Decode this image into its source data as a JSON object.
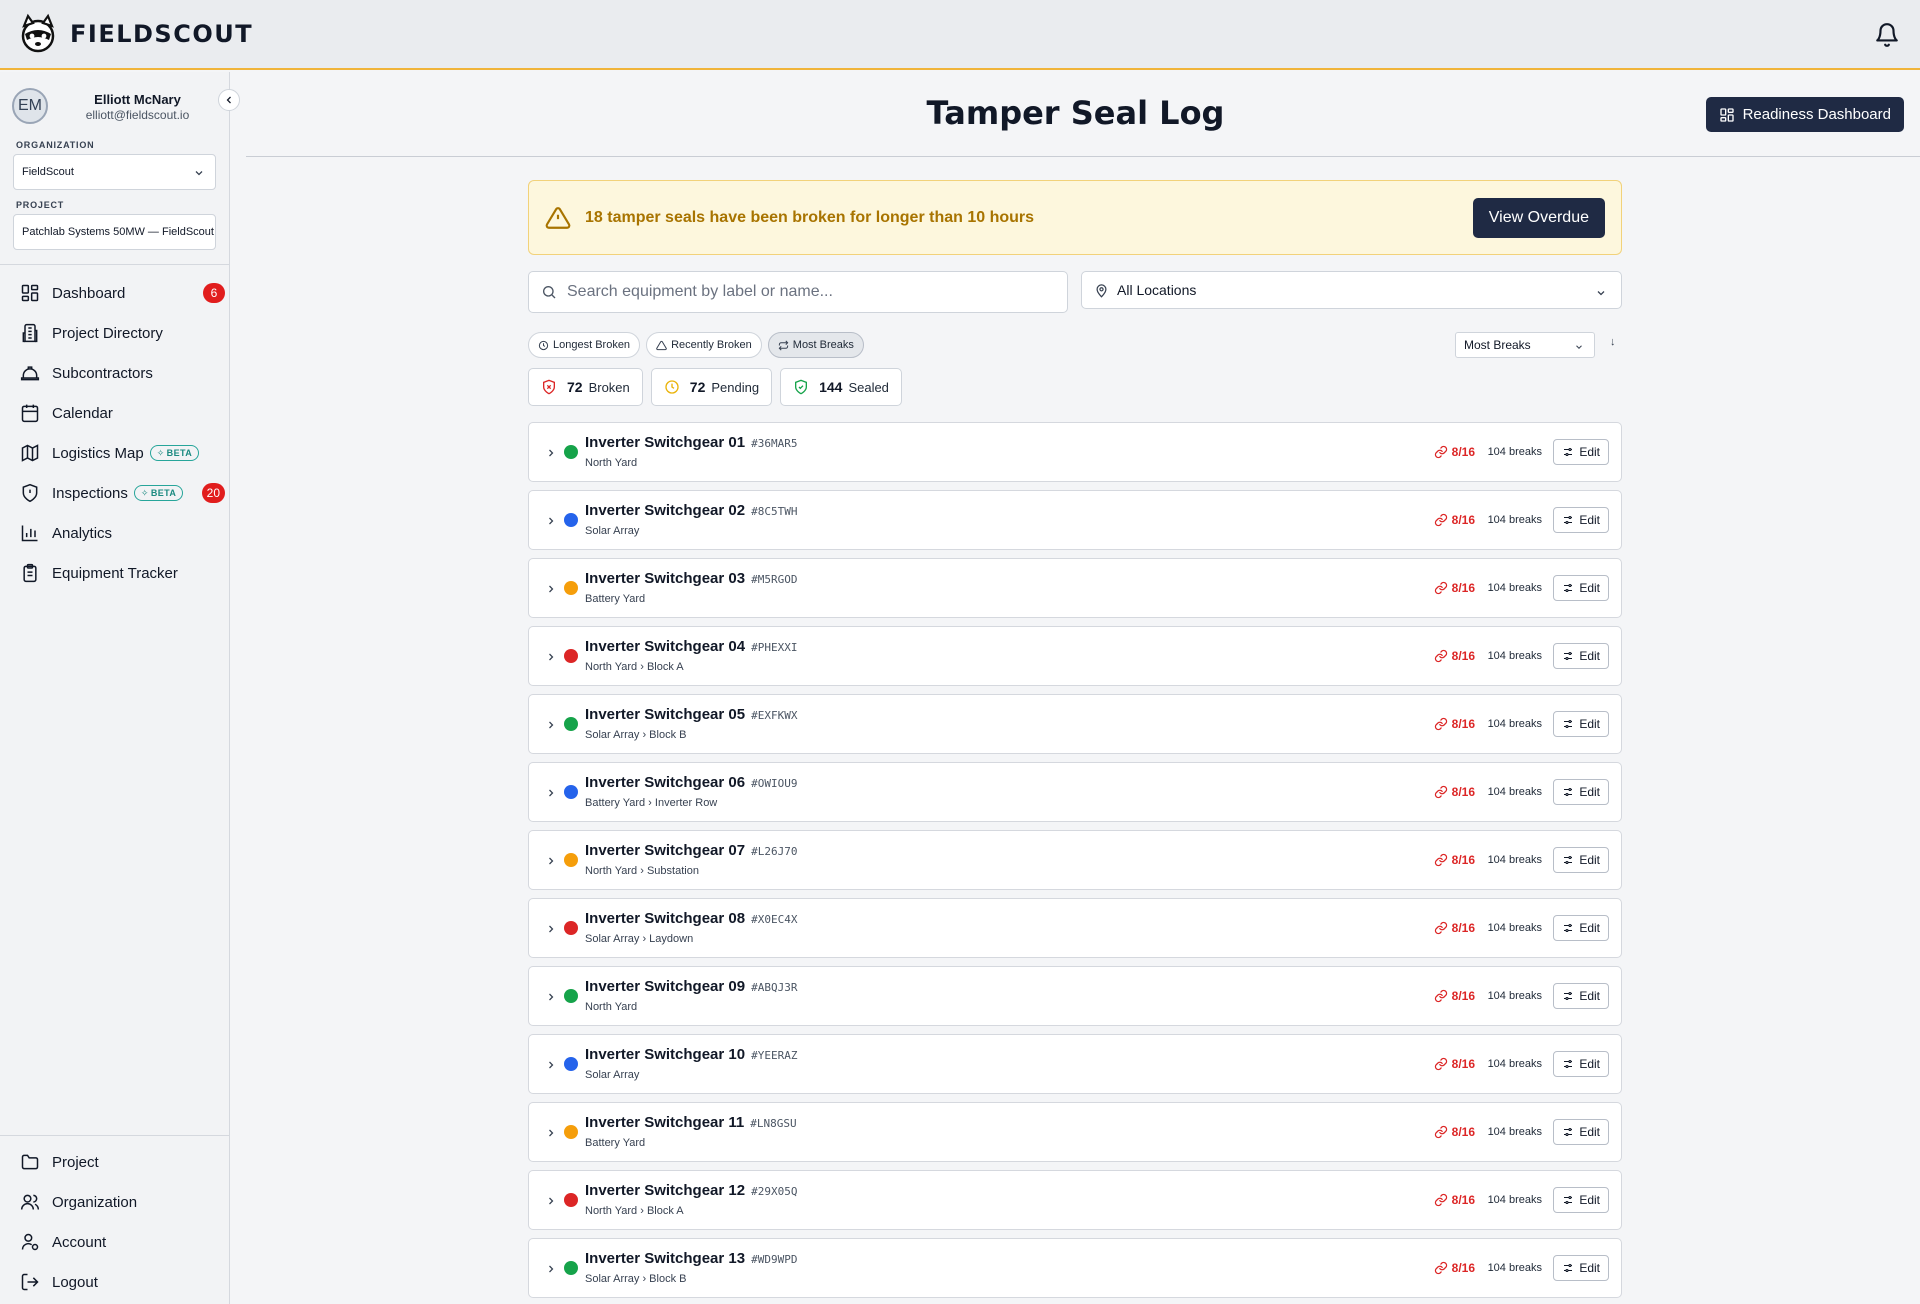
{
  "brand": {
    "name": "FIELDSCOUT"
  },
  "user": {
    "initials": "EM",
    "name": "Elliott McNary",
    "email": "elliott@fieldscout.io"
  },
  "org": {
    "label": "ORGANIZATION",
    "value": "FieldScout"
  },
  "project": {
    "label": "PROJECT",
    "value": "Patchlab Systems 50MW — FieldScout"
  },
  "nav": {
    "items": [
      {
        "label": "Dashboard",
        "icon": "dashboard-icon",
        "badge": "6"
      },
      {
        "label": "Project Directory",
        "icon": "building-icon"
      },
      {
        "label": "Subcontractors",
        "icon": "hardhat-icon"
      },
      {
        "label": "Calendar",
        "icon": "calendar-icon"
      },
      {
        "label": "Logistics Map",
        "icon": "map-icon",
        "beta": "BETA"
      },
      {
        "label": "Inspections",
        "icon": "shield-icon",
        "beta": "BETA",
        "badge": "20"
      },
      {
        "label": "Analytics",
        "icon": "bar-chart-icon"
      },
      {
        "label": "Equipment Tracker",
        "icon": "clipboard-icon"
      }
    ],
    "bottom": [
      {
        "label": "Project",
        "icon": "folder-icon"
      },
      {
        "label": "Organization",
        "icon": "users-icon"
      },
      {
        "label": "Account",
        "icon": "user-gear-icon"
      },
      {
        "label": "Logout",
        "icon": "logout-icon"
      }
    ]
  },
  "header": {
    "title": "Tamper Seal Log",
    "readiness_button": "Readiness Dashboard"
  },
  "alert": {
    "text": "18 tamper seals have been broken for longer than 10 hours",
    "button": "View Overdue"
  },
  "search": {
    "placeholder": "Search equipment by label or name..."
  },
  "location_filter": {
    "value": "All Locations"
  },
  "sort_chips": [
    {
      "label": "Longest Broken",
      "icon": "clock-icon"
    },
    {
      "label": "Recently Broken",
      "icon": "warning-icon"
    },
    {
      "label": "Most Breaks",
      "icon": "repeat-icon",
      "active": true
    }
  ],
  "sort_select": {
    "value": "Most Breaks",
    "direction": "↓"
  },
  "stats": [
    {
      "count": "72",
      "label": "Broken",
      "icon": "shield-broken-icon",
      "color": "#dc2626"
    },
    {
      "count": "72",
      "label": "Pending",
      "icon": "clock-icon",
      "color": "#eab308"
    },
    {
      "count": "144",
      "label": "Sealed",
      "icon": "shield-check-icon",
      "color": "#16a34a"
    }
  ],
  "colors": {
    "green": "#16a34a",
    "blue": "#2563eb",
    "orange": "#f59e0b",
    "red": "#dc2626",
    "navy": "#1f2a44",
    "accent": "#f0b43a"
  },
  "equipment": [
    {
      "name": "Inverter Switchgear 01",
      "code": "#36MAR5",
      "location": "North Yard",
      "status": "green",
      "seals": "8/16",
      "breaks": "104 breaks",
      "edit": "Edit"
    },
    {
      "name": "Inverter Switchgear 02",
      "code": "#8C5TWH",
      "location": "Solar Array",
      "status": "blue",
      "seals": "8/16",
      "breaks": "104 breaks",
      "edit": "Edit"
    },
    {
      "name": "Inverter Switchgear 03",
      "code": "#M5RGOD",
      "location": "Battery Yard",
      "status": "orange",
      "seals": "8/16",
      "breaks": "104 breaks",
      "edit": "Edit"
    },
    {
      "name": "Inverter Switchgear 04",
      "code": "#PHEXXI",
      "location": "North Yard › Block A",
      "status": "red",
      "seals": "8/16",
      "breaks": "104 breaks",
      "edit": "Edit"
    },
    {
      "name": "Inverter Switchgear 05",
      "code": "#EXFKWX",
      "location": "Solar Array › Block B",
      "status": "green",
      "seals": "8/16",
      "breaks": "104 breaks",
      "edit": "Edit"
    },
    {
      "name": "Inverter Switchgear 06",
      "code": "#OWIOU9",
      "location": "Battery Yard › Inverter Row",
      "status": "blue",
      "seals": "8/16",
      "breaks": "104 breaks",
      "edit": "Edit"
    },
    {
      "name": "Inverter Switchgear 07",
      "code": "#L26J70",
      "location": "North Yard › Substation",
      "status": "orange",
      "seals": "8/16",
      "breaks": "104 breaks",
      "edit": "Edit"
    },
    {
      "name": "Inverter Switchgear 08",
      "code": "#X0EC4X",
      "location": "Solar Array › Laydown",
      "status": "red",
      "seals": "8/16",
      "breaks": "104 breaks",
      "edit": "Edit"
    },
    {
      "name": "Inverter Switchgear 09",
      "code": "#ABQJ3R",
      "location": "North Yard",
      "status": "green",
      "seals": "8/16",
      "breaks": "104 breaks",
      "edit": "Edit"
    },
    {
      "name": "Inverter Switchgear 10",
      "code": "#YEERAZ",
      "location": "Solar Array",
      "status": "blue",
      "seals": "8/16",
      "breaks": "104 breaks",
      "edit": "Edit"
    },
    {
      "name": "Inverter Switchgear 11",
      "code": "#LN8GSU",
      "location": "Battery Yard",
      "status": "orange",
      "seals": "8/16",
      "breaks": "104 breaks",
      "edit": "Edit"
    },
    {
      "name": "Inverter Switchgear 12",
      "code": "#29X05Q",
      "location": "North Yard › Block A",
      "status": "red",
      "seals": "8/16",
      "breaks": "104 breaks",
      "edit": "Edit"
    },
    {
      "name": "Inverter Switchgear 13",
      "code": "#WD9WPD",
      "location": "Solar Array › Block B",
      "status": "green",
      "seals": "8/16",
      "breaks": "104 breaks",
      "edit": "Edit"
    }
  ]
}
